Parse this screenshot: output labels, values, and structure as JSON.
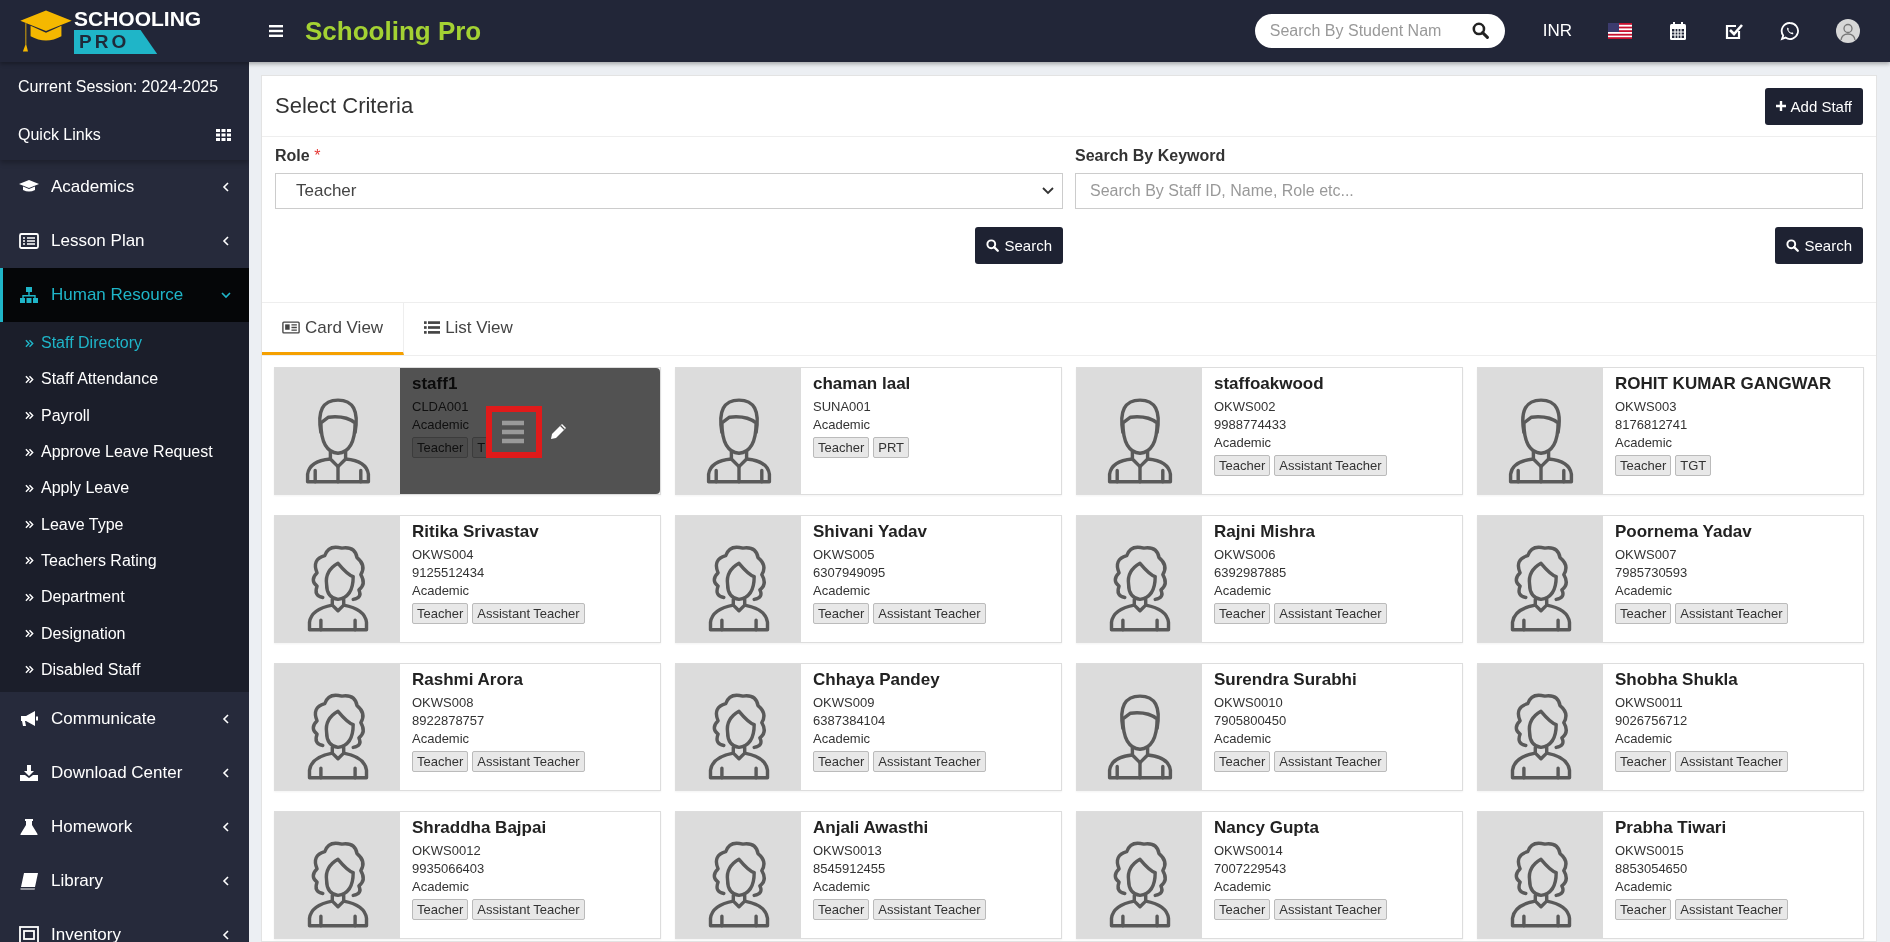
{
  "app": {
    "logo_top": "SCHOOLING",
    "logo_bottom": "PRO",
    "title": "Schooling Pro"
  },
  "topbar": {
    "search_placeholder": "Search By Student Nam",
    "currency": "INR"
  },
  "sidebar": {
    "session": "Current Session: 2024-2025",
    "quick_links": "Quick Links",
    "menu": [
      {
        "label": "Academics",
        "expanded": false
      },
      {
        "label": "Lesson Plan",
        "expanded": false
      },
      {
        "label": "Human Resource",
        "expanded": true,
        "children": [
          {
            "label": "Staff Directory",
            "selected": true
          },
          {
            "label": "Staff Attendance",
            "selected": false
          },
          {
            "label": "Payroll",
            "selected": false
          },
          {
            "label": "Approve Leave Request",
            "selected": false
          },
          {
            "label": "Apply Leave",
            "selected": false
          },
          {
            "label": "Leave Type",
            "selected": false
          },
          {
            "label": "Teachers Rating",
            "selected": false
          },
          {
            "label": "Department",
            "selected": false
          },
          {
            "label": "Designation",
            "selected": false
          },
          {
            "label": "Disabled Staff",
            "selected": false
          }
        ]
      },
      {
        "label": "Communicate",
        "expanded": false
      },
      {
        "label": "Download Center",
        "expanded": false
      },
      {
        "label": "Homework",
        "expanded": false
      },
      {
        "label": "Library",
        "expanded": false
      },
      {
        "label": "Inventory",
        "expanded": false
      }
    ]
  },
  "criteria": {
    "title": "Select Criteria",
    "add_button": "Add Staff",
    "role_label": "Role",
    "required_mark": "*",
    "role_value": "Teacher",
    "keyword_label": "Search By Keyword",
    "keyword_placeholder": "Search By Staff ID, Name, Role etc...",
    "search_buttons": [
      "Search",
      "Search"
    ]
  },
  "tabs": [
    {
      "label": "Card View",
      "selected": true
    },
    {
      "label": "List View",
      "selected": false
    }
  ],
  "staff": [
    {
      "name": "staff1",
      "id": "CLDA001",
      "dept": "Academic",
      "tags": [
        "Teacher",
        "T"
      ],
      "kind": "male",
      "hovered": true
    },
    {
      "name": "chaman laal",
      "id": "SUNA001",
      "dept": "Academic",
      "tags": [
        "Teacher",
        "PRT"
      ],
      "kind": "male",
      "hovered": false
    },
    {
      "name": "staffoakwood",
      "id": "OKWS002",
      "phone": "9988774433",
      "dept": "Academic",
      "tags": [
        "Teacher",
        "Assistant Teacher"
      ],
      "kind": "male",
      "hovered": false
    },
    {
      "name": "ROHIT KUMAR GANGWAR",
      "id": "OKWS003",
      "phone": "8176812741",
      "dept": "Academic",
      "tags": [
        "Teacher",
        "TGT"
      ],
      "kind": "male",
      "hovered": false
    },
    {
      "name": "Ritika Srivastav",
      "id": "OKWS004",
      "phone": "9125512434",
      "dept": "Academic",
      "tags": [
        "Teacher",
        "Assistant Teacher"
      ],
      "kind": "female",
      "hovered": false
    },
    {
      "name": "Shivani Yadav",
      "id": "OKWS005",
      "phone": "6307949095",
      "dept": "Academic",
      "tags": [
        "Teacher",
        "Assistant Teacher"
      ],
      "kind": "female",
      "hovered": false
    },
    {
      "name": "Rajni Mishra",
      "id": "OKWS006",
      "phone": "6392987885",
      "dept": "Academic",
      "tags": [
        "Teacher",
        "Assistant Teacher"
      ],
      "kind": "female",
      "hovered": false
    },
    {
      "name": "Poornema Yadav",
      "id": "OKWS007",
      "phone": "7985730593",
      "dept": "Academic",
      "tags": [
        "Teacher",
        "Assistant Teacher"
      ],
      "kind": "female",
      "hovered": false
    },
    {
      "name": "Rashmi Arora",
      "id": "OKWS008",
      "phone": "8922878757",
      "dept": "Academic",
      "tags": [
        "Teacher",
        "Assistant Teacher"
      ],
      "kind": "female",
      "hovered": false
    },
    {
      "name": "Chhaya Pandey",
      "id": "OKWS009",
      "phone": "6387384104",
      "dept": "Academic",
      "tags": [
        "Teacher",
        "Assistant Teacher"
      ],
      "kind": "female",
      "hovered": false
    },
    {
      "name": "Surendra Surabhi",
      "id": "OKWS0010",
      "phone": "7905800450",
      "dept": "Academic",
      "tags": [
        "Teacher",
        "Assistant Teacher"
      ],
      "kind": "male",
      "hovered": false
    },
    {
      "name": "Shobha Shukla",
      "id": "OKWS0011",
      "phone": "9026756712",
      "dept": "Academic",
      "tags": [
        "Teacher",
        "Assistant Teacher"
      ],
      "kind": "female",
      "hovered": false
    },
    {
      "name": "Shraddha Bajpai",
      "id": "OKWS0012",
      "phone": "9935066403",
      "dept": "Academic",
      "tags": [
        "Teacher",
        "Assistant Teacher"
      ],
      "kind": "female",
      "hovered": false
    },
    {
      "name": "Anjali Awasthi",
      "id": "OKWS0013",
      "phone": "8545912455",
      "dept": "Academic",
      "tags": [
        "Teacher",
        "Assistant Teacher"
      ],
      "kind": "female",
      "hovered": false
    },
    {
      "name": "Nancy Gupta",
      "id": "OKWS0014",
      "phone": "7007229543",
      "dept": "Academic",
      "tags": [
        "Teacher",
        "Assistant Teacher"
      ],
      "kind": "female",
      "hovered": false
    },
    {
      "name": "Prabha Tiwari",
      "id": "OKWS0015",
      "phone": "8853054650",
      "dept": "Academic",
      "tags": [
        "Teacher",
        "Assistant Teacher"
      ],
      "kind": "female",
      "hovered": false
    }
  ]
}
